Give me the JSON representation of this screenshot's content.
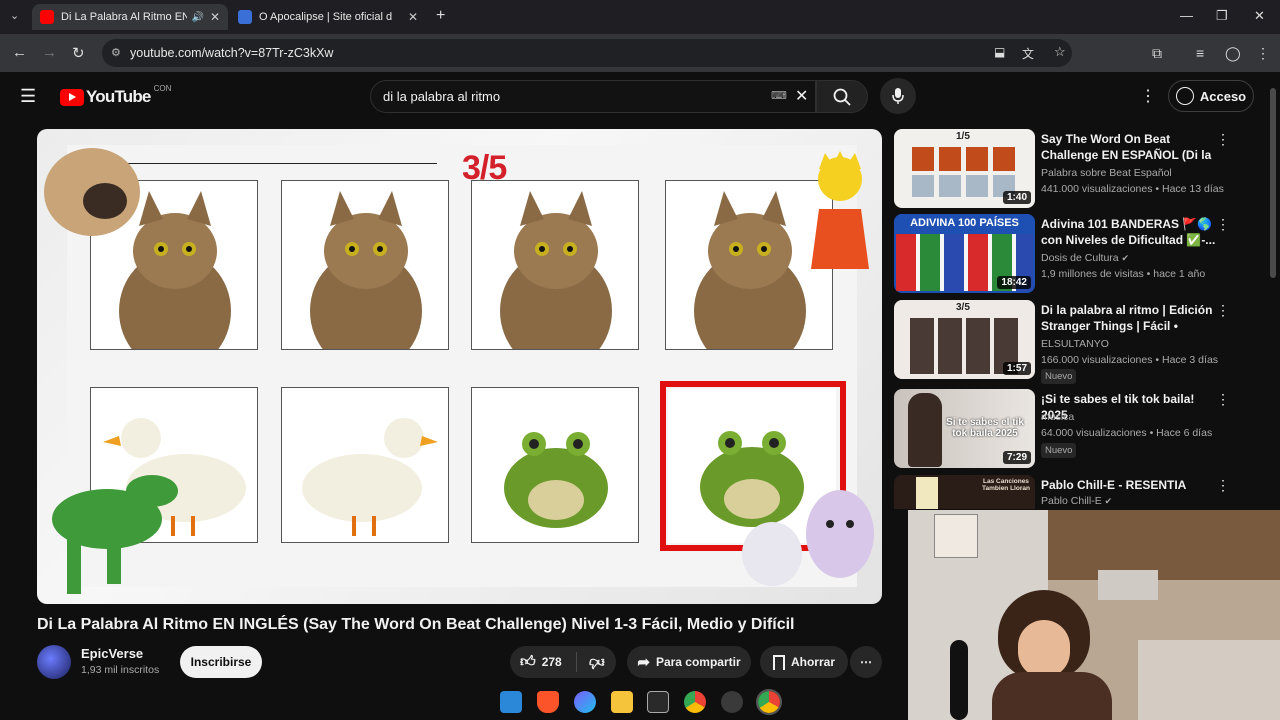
{
  "browser": {
    "tabs": [
      {
        "title": "Di La Palabra Al Ritmo EN INGLÉS",
        "active": true
      },
      {
        "title": "O Apocalipse | Site oficial d",
        "active": false
      }
    ],
    "url": "youtube.com/watch?v=87Tr-zC3kXw"
  },
  "header": {
    "logo_text": "YouTube",
    "region": "CON",
    "search_value": "di la palabra al ritmo",
    "sign_in": "Acceso"
  },
  "video": {
    "counter": "3/5",
    "title": "Di La Palabra Al Ritmo EN INGLÉS (Say The Word On Beat Challenge) Nivel 1-3 Fácil, Medio y Difícil",
    "channel": "EpicVerse",
    "subscribers": "1,93 mil inscritos",
    "subscribe_label": "Inscribirse",
    "likes": "278",
    "share_label": "Para compartir",
    "save_label": "Ahorrar"
  },
  "recommendations": [
    {
      "title": "Say The Word On Beat Challenge EN ESPAÑOL (Di la ...",
      "channel": "Palabra sobre Beat Español",
      "stats": "441.000 visualizaciones • Hace 13 días",
      "duration": "1:40",
      "badge": "",
      "thumb_text": "1/5"
    },
    {
      "title": "Adivina 101 BANDERAS 🚩🌎 con Niveles de Dificultad ✅-...",
      "channel": "Dosis de Cultura",
      "stats": "1,9 millones de visitas • hace 1 año",
      "duration": "18:42",
      "badge": "",
      "thumb_text": "ADIVINA 100 PAÍSES"
    },
    {
      "title": "Di la palabra al ritmo | Edición Stranger Things | Fácil • Medio...",
      "channel": "ELSULTANYO",
      "stats": "166.000 visualizaciones • Hace 3 días",
      "duration": "1:57",
      "badge": "Nuevo",
      "thumb_text": "3/5"
    },
    {
      "title": "¡Si te sabes el tik tok baila! 2025",
      "channel": "música",
      "stats": "64.000 visualizaciones • Hace 6 días",
      "duration": "7:29",
      "badge": "Nuevo",
      "thumb_text": "Si te sabes el tik tok baila 2025"
    },
    {
      "title": "Pablo Chill-E - RESENTIA",
      "channel": "Pablo Chill-E",
      "stats": "",
      "duration": "",
      "badge": "",
      "thumb_text": "Las Canciones Tambien Lloran"
    }
  ],
  "colors": {
    "accent_red": "#ff0000",
    "counter_red": "#d3202a"
  }
}
